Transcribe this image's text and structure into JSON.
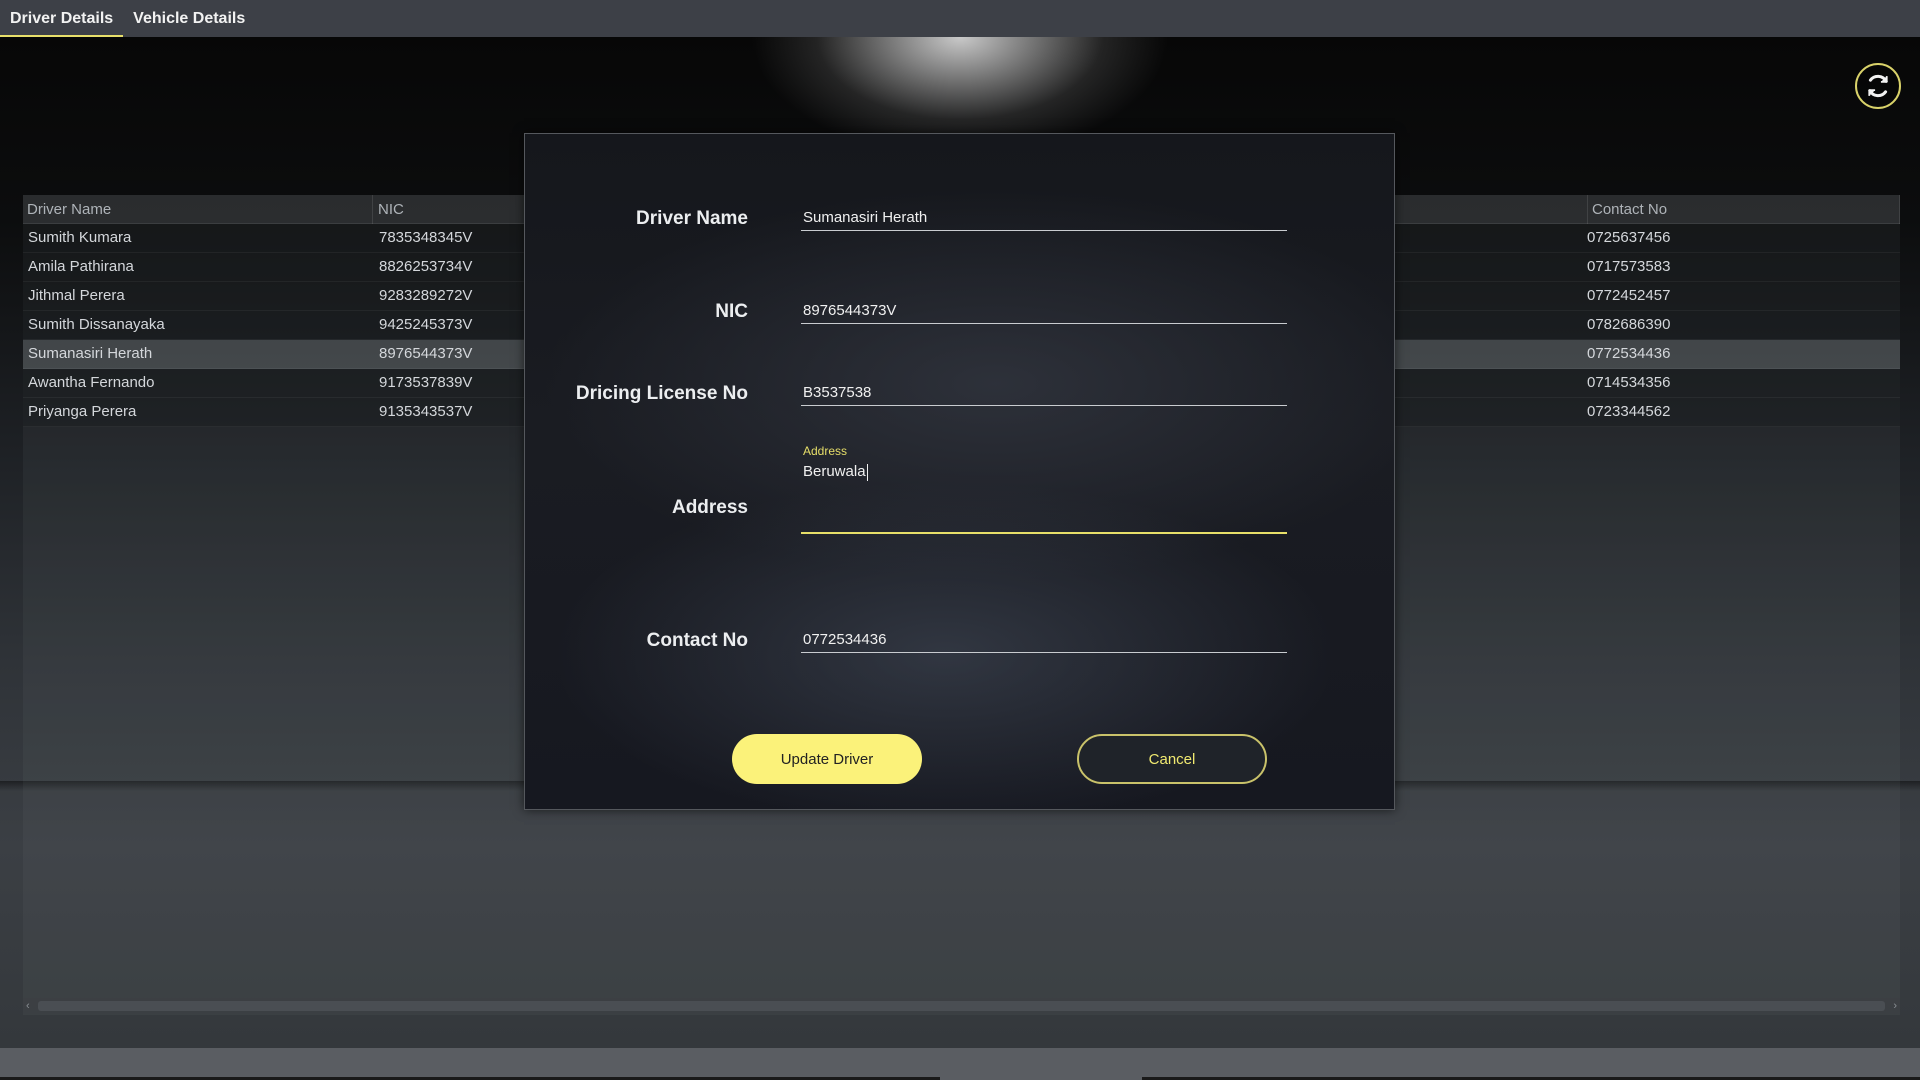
{
  "tabs": [
    {
      "label": "Driver Details",
      "active": true
    },
    {
      "label": "Vehicle Details",
      "active": false
    }
  ],
  "refresh": {
    "icon": "refresh-icon"
  },
  "table": {
    "columns": [
      "Driver Name",
      "NIC",
      "Contact No"
    ],
    "rows": [
      {
        "name": "Sumith Kumara",
        "nic": "7835348345V",
        "contact": "0725637456"
      },
      {
        "name": "Amila Pathirana",
        "nic": "8826253734V",
        "contact": "0717573583"
      },
      {
        "name": "Jithmal Perera",
        "nic": "9283289272V",
        "contact": "0772452457"
      },
      {
        "name": "Sumith Dissanayaka",
        "nic": "9425245373V",
        "contact": "0782686390"
      },
      {
        "name": "Sumanasiri Herath",
        "nic": "8976544373V",
        "contact": "0772534436",
        "selected": true
      },
      {
        "name": "Awantha Fernando",
        "nic": "9173537839V",
        "contact": "0714534356"
      },
      {
        "name": "Priyanga Perera",
        "nic": "9135343537V",
        "contact": "0723344562"
      }
    ]
  },
  "modal": {
    "driver_name": {
      "label": "Driver Name",
      "value": "Sumanasiri Herath"
    },
    "nic": {
      "label": "NIC",
      "value": "8976544373V"
    },
    "license": {
      "label": "Dricing License No",
      "value": "B3537538"
    },
    "address": {
      "label": "Address",
      "float_label": "Address",
      "value": "Beruwala"
    },
    "contact": {
      "label": "Contact No",
      "value": "0772534436"
    },
    "update_button": "Update Driver",
    "cancel_button": "Cancel"
  },
  "colors": {
    "accent": "#fbf27a",
    "focus": "#e7df69"
  }
}
